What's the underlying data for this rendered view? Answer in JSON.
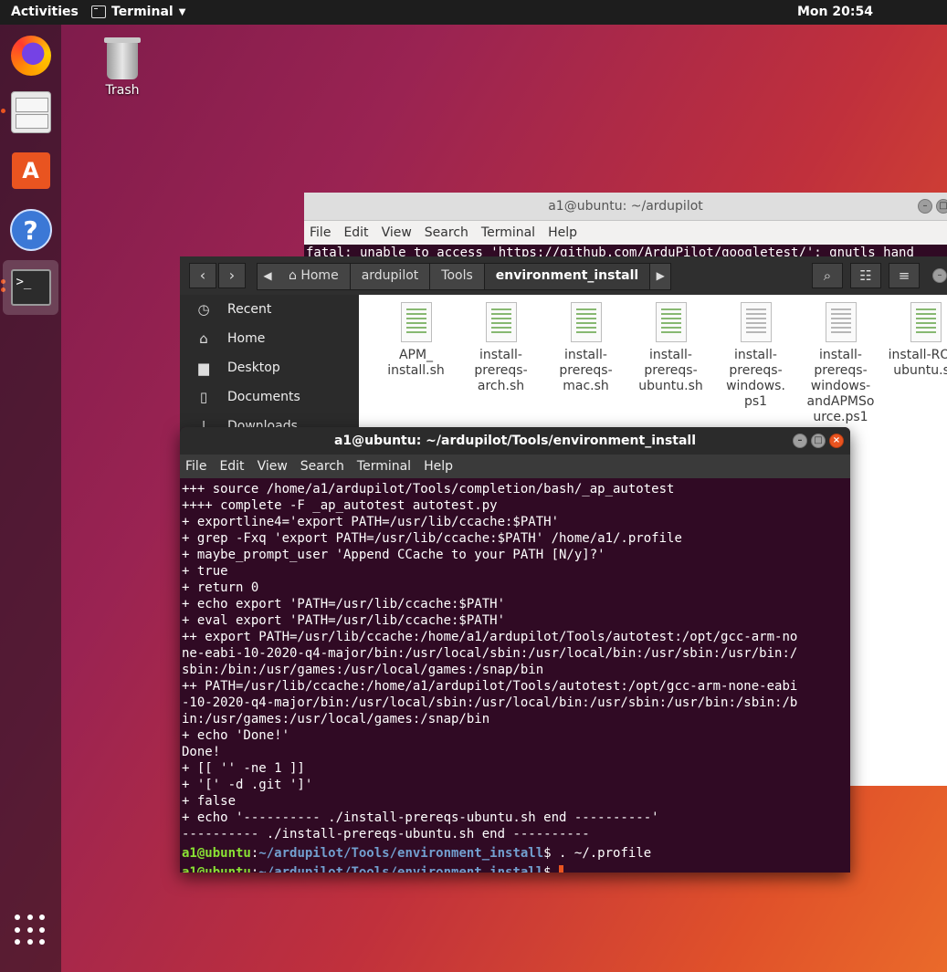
{
  "topbar": {
    "activities": "Activities",
    "app_name": "Terminal",
    "clock": "Mon 20:54"
  },
  "desktop": {
    "trash_label": "Trash"
  },
  "dock": {
    "items": [
      {
        "name": "firefox-icon"
      },
      {
        "name": "files-icon"
      },
      {
        "name": "software-icon"
      },
      {
        "name": "help-icon"
      },
      {
        "name": "terminal-icon"
      }
    ]
  },
  "term_back": {
    "title": "a1@ubuntu: ~/ardupilot",
    "menu": [
      "File",
      "Edit",
      "View",
      "Search",
      "Terminal",
      "Help"
    ],
    "line": "fatal: unable to access 'https://github.com/ArduPilot/googletest/': gnutls_hand"
  },
  "files": {
    "path": [
      "Home",
      "ardupilot",
      "Tools",
      "environment_install"
    ],
    "sidebar": [
      "Recent",
      "Home",
      "Desktop",
      "Documents",
      "Downloads"
    ],
    "items": [
      {
        "label": "APM_\ninstall.sh"
      },
      {
        "label": "install-\nprereqs-\narch.sh"
      },
      {
        "label": "install-\nprereqs-\nmac.sh"
      },
      {
        "label": "install-\nprereqs-\nubuntu.sh"
      },
      {
        "label": "install-\nprereqs-\nwindows.\nps1"
      },
      {
        "label": "install-\nprereqs-\nwindows-\nandAPMSo\nurce.ps1"
      },
      {
        "label": "install-ROS-\nubuntu.sh"
      }
    ]
  },
  "term_front": {
    "title": "a1@ubuntu: ~/ardupilot/Tools/environment_install",
    "menu": [
      "File",
      "Edit",
      "View",
      "Search",
      "Terminal",
      "Help"
    ],
    "output": "+++ source /home/a1/ardupilot/Tools/completion/bash/_ap_autotest\n++++ complete -F _ap_autotest autotest.py\n+ exportline4='export PATH=/usr/lib/ccache:$PATH'\n+ grep -Fxq 'export PATH=/usr/lib/ccache:$PATH' /home/a1/.profile\n+ maybe_prompt_user 'Append CCache to your PATH [N/y]?'\n+ true\n+ return 0\n+ echo export 'PATH=/usr/lib/ccache:$PATH'\n+ eval export 'PATH=/usr/lib/ccache:$PATH'\n++ export PATH=/usr/lib/ccache:/home/a1/ardupilot/Tools/autotest:/opt/gcc-arm-no\nne-eabi-10-2020-q4-major/bin:/usr/local/sbin:/usr/local/bin:/usr/sbin:/usr/bin:/\nsbin:/bin:/usr/games:/usr/local/games:/snap/bin\n++ PATH=/usr/lib/ccache:/home/a1/ardupilot/Tools/autotest:/opt/gcc-arm-none-eabi\n-10-2020-q4-major/bin:/usr/local/sbin:/usr/local/bin:/usr/sbin:/usr/bin:/sbin:/b\nin:/usr/games:/usr/local/games:/snap/bin\n+ echo 'Done!'\nDone!\n+ [[ '' -ne 1 ]]\n+ '[' -d .git ']'\n+ false\n+ echo '---------- ./install-prereqs-ubuntu.sh end ----------'\n---------- ./install-prereqs-ubuntu.sh end ----------",
    "prompt_user": "a1@ubuntu",
    "prompt_path": "~/ardupilot/Tools/environment_install",
    "prompt_dollar": "$ ",
    "command1": ". ~/.profile",
    "command2": ""
  }
}
